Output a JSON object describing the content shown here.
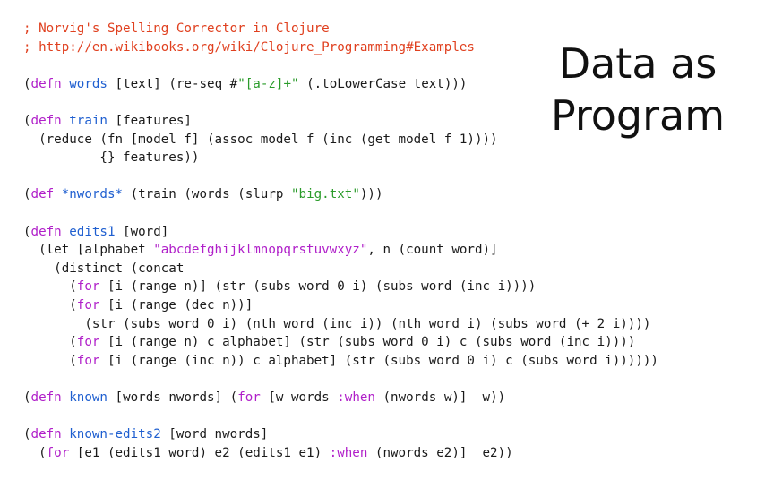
{
  "title": {
    "line1": "Data as",
    "line2": "Program"
  },
  "code_lines": [
    [
      {
        "t": "; Norvig's Spelling Corrector in Clojure",
        "c": "cm"
      }
    ],
    [
      {
        "t": "; http://en.wikibooks.org/wiki/Clojure_Programming#Examples",
        "c": "cm"
      }
    ],
    [],
    [
      {
        "t": "(",
        "c": ""
      },
      {
        "t": "defn",
        "c": "pu"
      },
      {
        "t": " ",
        "c": ""
      },
      {
        "t": "words",
        "c": "kw"
      },
      {
        "t": " [text] (re-seq #",
        "c": ""
      },
      {
        "t": "\"[a-z]+\"",
        "c": "st"
      },
      {
        "t": " (.toLowerCase text)))",
        "c": ""
      }
    ],
    [],
    [
      {
        "t": "(",
        "c": ""
      },
      {
        "t": "defn",
        "c": "pu"
      },
      {
        "t": " ",
        "c": ""
      },
      {
        "t": "train",
        "c": "kw"
      },
      {
        "t": " [features]",
        "c": ""
      }
    ],
    [
      {
        "t": "  (reduce (fn [model f] (assoc model f (inc (get model f 1))))",
        "c": ""
      }
    ],
    [
      {
        "t": "          {} features))",
        "c": ""
      }
    ],
    [],
    [
      {
        "t": "(",
        "c": ""
      },
      {
        "t": "def",
        "c": "pu"
      },
      {
        "t": " ",
        "c": ""
      },
      {
        "t": "*nwords*",
        "c": "kw"
      },
      {
        "t": " (train (words (slurp ",
        "c": ""
      },
      {
        "t": "\"big.txt\"",
        "c": "st"
      },
      {
        "t": ")))",
        "c": ""
      }
    ],
    [],
    [
      {
        "t": "(",
        "c": ""
      },
      {
        "t": "defn",
        "c": "pu"
      },
      {
        "t": " ",
        "c": ""
      },
      {
        "t": "edits1",
        "c": "kw"
      },
      {
        "t": " [word]",
        "c": ""
      }
    ],
    [
      {
        "t": "  (let [alphabet ",
        "c": ""
      },
      {
        "t": "\"abcdefghijklmnopqrstuvwxyz\"",
        "c": "pu"
      },
      {
        "t": ", n (count word)]",
        "c": ""
      }
    ],
    [
      {
        "t": "    (distinct (concat",
        "c": ""
      }
    ],
    [
      {
        "t": "      (",
        "c": ""
      },
      {
        "t": "for",
        "c": "pu"
      },
      {
        "t": " [i (range n)] (str (subs word 0 i) (subs word (inc i))))",
        "c": ""
      }
    ],
    [
      {
        "t": "      (",
        "c": ""
      },
      {
        "t": "for",
        "c": "pu"
      },
      {
        "t": " [i (range (dec n))]",
        "c": ""
      }
    ],
    [
      {
        "t": "        (str (subs word 0 i) (nth word (inc i)) (nth word i) (subs word (+ 2 i))))",
        "c": ""
      }
    ],
    [
      {
        "t": "      (",
        "c": ""
      },
      {
        "t": "for",
        "c": "pu"
      },
      {
        "t": " [i (range n) c alphabet] (str (subs word 0 i) c (subs word (inc i))))",
        "c": ""
      }
    ],
    [
      {
        "t": "      (",
        "c": ""
      },
      {
        "t": "for",
        "c": "pu"
      },
      {
        "t": " [i (range (inc n)) c alphabet] (str (subs word 0 i) c (subs word i))))))",
        "c": ""
      }
    ],
    [],
    [
      {
        "t": "(",
        "c": ""
      },
      {
        "t": "defn",
        "c": "pu"
      },
      {
        "t": " ",
        "c": ""
      },
      {
        "t": "known",
        "c": "kw"
      },
      {
        "t": " [words nwords] (",
        "c": ""
      },
      {
        "t": "for",
        "c": "pu"
      },
      {
        "t": " [w words ",
        "c": ""
      },
      {
        "t": ":when",
        "c": "pu"
      },
      {
        "t": " (nwords w)]  w))",
        "c": ""
      }
    ],
    [],
    [
      {
        "t": "(",
        "c": ""
      },
      {
        "t": "defn",
        "c": "pu"
      },
      {
        "t": " ",
        "c": ""
      },
      {
        "t": "known-edits2",
        "c": "kw"
      },
      {
        "t": " [word nwords]",
        "c": ""
      }
    ],
    [
      {
        "t": "  (",
        "c": ""
      },
      {
        "t": "for",
        "c": "pu"
      },
      {
        "t": " [e1 (edits1 word) e2 (edits1 e1) ",
        "c": ""
      },
      {
        "t": ":when",
        "c": "pu"
      },
      {
        "t": " (nwords e2)]  e2))",
        "c": ""
      }
    ]
  ],
  "colors": {
    "comment": "#e0401f",
    "symbol": "#1f5fd0",
    "keyword": "#b01fc9",
    "string": "#2a9b2a",
    "text": "#1a1a1a",
    "background": "#ffffff"
  }
}
